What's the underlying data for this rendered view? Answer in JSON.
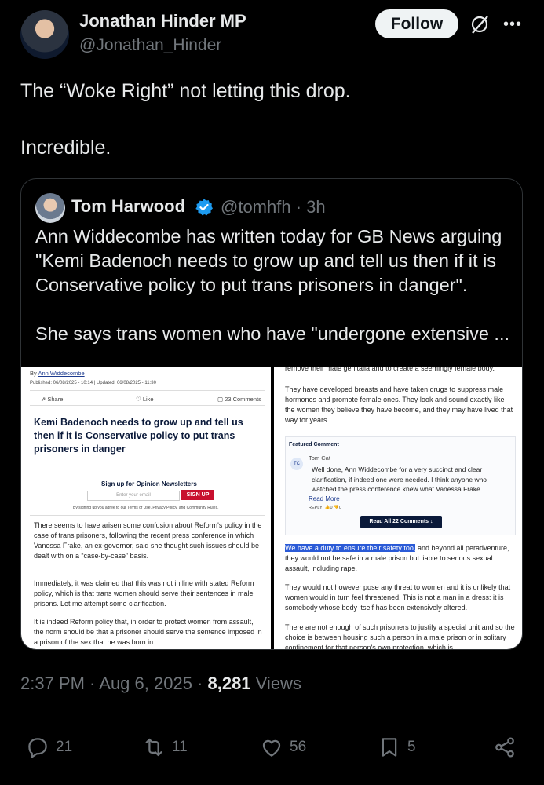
{
  "author": {
    "name": "Jonathan Hinder MP",
    "handle": "@Jonathan_Hinder",
    "follow_label": "Follow"
  },
  "tweet": {
    "text": "The “Woke Right” not letting this drop.\n\nIncredible."
  },
  "quote": {
    "name": "Tom Harwood",
    "handle": "@tomhfh",
    "time": "· 3h",
    "text": "Ann Widdecombe has written today for GB News arguing \"Kemi Badenoch needs to grow up and tell us then if it is Conservative policy to put trans prisoners in danger\".\n\nShe says trans women who have \"undergone extensive ..."
  },
  "article_left": {
    "by_prefix": "By ",
    "byline": "Ann Widdecombe",
    "published": "Published: 06/08/2025 - 10:14 | Updated: 06/08/2025 - 11:30",
    "share": "Share",
    "like": "Like",
    "comments": "23 Comments",
    "headline": "Kemi Badenoch needs to grow up and tell us then if it is Conservative policy to put trans prisoners in danger",
    "signup_title": "Sign up for Opinion Newsletters",
    "email_placeholder": "Enter your email",
    "signup_button": "SIGN UP",
    "terms": "By signing up you agree to our Terms of Use, Privacy Policy, and Community Rules.",
    "paragraphs": [
      "There seems to have arisen some confusion about Reform's policy in the case of trans prisoners, following the recent press conference in which Vanessa Frake, an ex-governor, said she thought such issues should be dealt with on a “case-by-case” basis.",
      "Immediately, it was claimed that this was not in line with stated Reform policy, which is that trans women should serve their sentences in male prisons. Let me attempt some clarification.",
      "It is indeed Reform policy that, in order to protect women from assault, the norm should be that a prisoner should serve the sentence imposed in a prison of the sex that he was born in."
    ]
  },
  "article_right": {
    "top_cut": "remove their male genitalia and to create a seemingly female body.",
    "para1": "They have developed breasts and have taken drugs to suppress male hormones and promote female ones. They look and sound exactly like the women they believe they have become, and they may have lived that way for years.",
    "featured_label": "Featured Comment",
    "commenter_initials": "TC",
    "commenter": "Tom Cat",
    "comment": "Well done, Ann Widdecombe for a very succinct and clear clarification, if indeed one were needed. I think anyone who watched the press conference knew what Vanessa Frake..",
    "read_more": "Read More",
    "reply": "REPLY",
    "up": "0",
    "down": "0",
    "read_all": "Read All 22 Comments ↓",
    "highlighted": "We have a duty to ensure their safety too,",
    "para2_rest": " and beyond all peradventure, they would not be safe in a male prison but liable to serious sexual assault, including rape.",
    "para3": "They would not however pose any threat to women and it is unlikely that women would in turn feel threatened. This is not a man in a dress: it is somebody whose body itself has been extensively altered.",
    "para4": "There are not enough of such prisoners to justify a special unit and so the choice is between housing such a person in a male prison or in solitary confinement for that person's own protection, which is"
  },
  "meta": {
    "time": "2:37 PM · Aug 6, 2025 · ",
    "views": "8,281",
    "views_label": " Views"
  },
  "actions": {
    "replies": "21",
    "reposts": "11",
    "likes": "56",
    "bookmarks": "5"
  },
  "colors": {
    "background": "#000000",
    "text": "#e7e9ea",
    "muted": "#71767b",
    "verified": "#1d9bf0",
    "border": "#2f3336"
  },
  "icons": [
    "grok-icon",
    "more-icon",
    "verified-badge-icon",
    "reply-icon",
    "repost-icon",
    "like-icon",
    "bookmark-icon",
    "share-icon"
  ]
}
